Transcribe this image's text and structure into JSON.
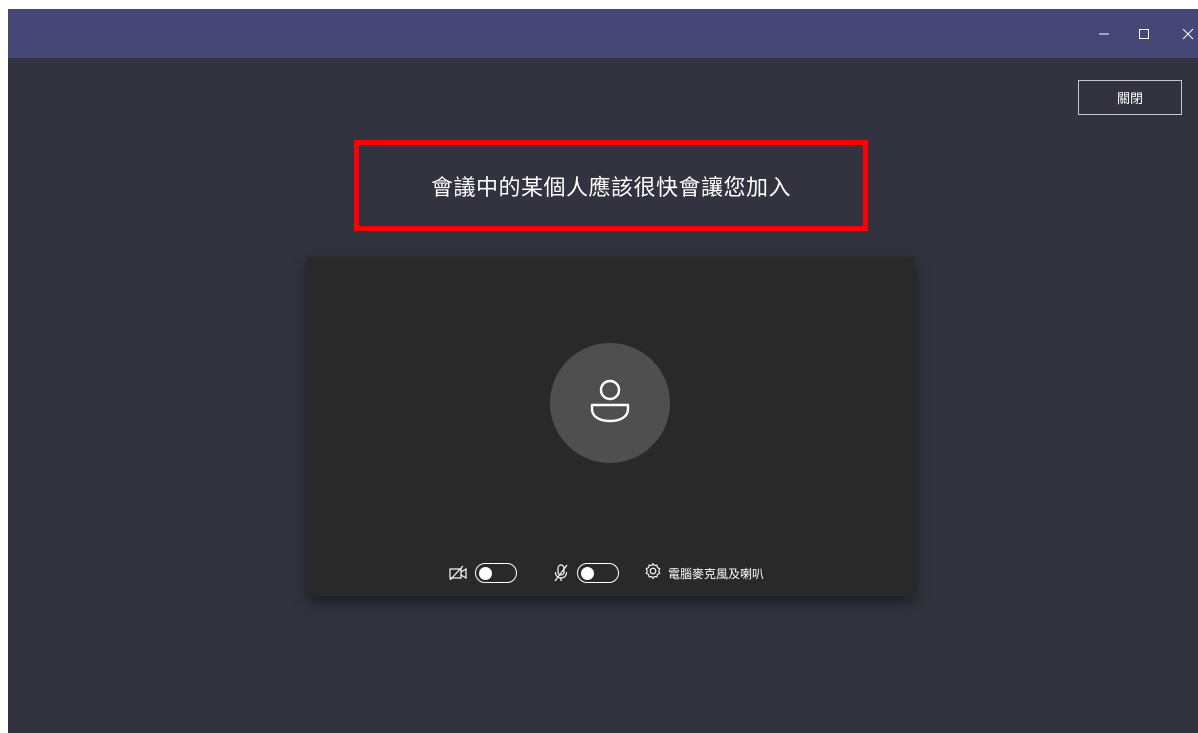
{
  "window": {
    "controls": {
      "minimize_icon": "minimize-icon",
      "maximize_icon": "maximize-icon",
      "close_icon": "close-icon"
    }
  },
  "header": {
    "close_button_label": "關閉"
  },
  "lobby": {
    "message": "會議中的某個人應該很快會讓您加入",
    "highlight_color": "#ff0000"
  },
  "preview": {
    "avatar_icon": "person-icon",
    "camera": {
      "icon": "camera-off-icon",
      "state": "off"
    },
    "microphone": {
      "icon": "mic-off-icon",
      "state": "off"
    },
    "device_settings": {
      "icon": "gear-icon",
      "label": "電腦麥克風及喇叭"
    }
  },
  "colors": {
    "titlebar": "#464776",
    "background": "#33333f",
    "preview_bg": "#292929",
    "avatar_bg": "#4f4f4f"
  }
}
